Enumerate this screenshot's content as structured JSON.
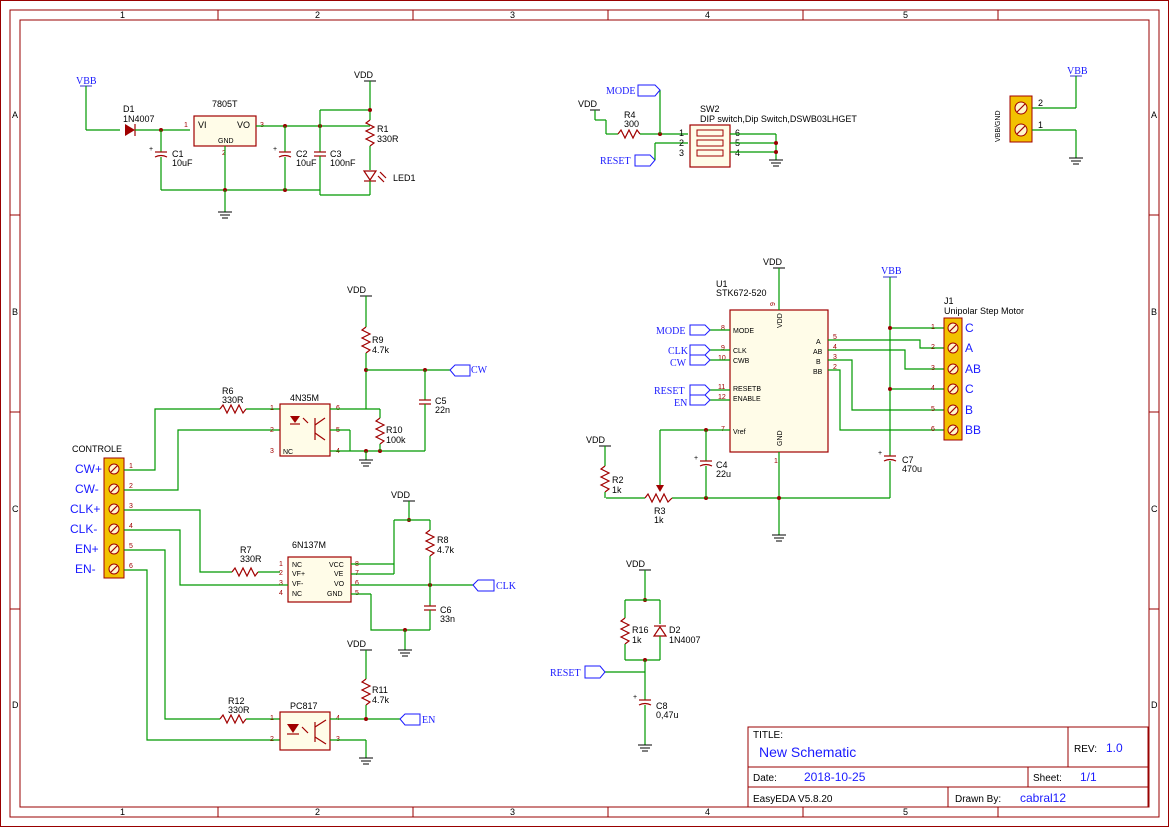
{
  "frame": {
    "columns": [
      "1",
      "2",
      "3",
      "4",
      "5"
    ],
    "rows": [
      "A",
      "B",
      "C",
      "D"
    ]
  },
  "title_block": {
    "title_label": "TITLE:",
    "title": "New Schematic",
    "rev_label": "REV:",
    "rev": "1.0",
    "date_label": "Date:",
    "date": "2018-10-25",
    "sheet_label": "Sheet:",
    "sheet": "1/1",
    "tool": "EasyEDA V5.8.20",
    "drawn_label": "Drawn By:",
    "drawn": "cabral12"
  },
  "power": {
    "vbb": "VBB",
    "vdd": "VDD"
  },
  "power_section": {
    "d1_ref": "D1",
    "d1_val": "1N4007",
    "reg_ref": "7805T",
    "reg_vi": "VI",
    "reg_vo": "VO",
    "reg_gnd": "GND",
    "c1_ref": "C1",
    "c1_val": "10uF",
    "c2_ref": "C2",
    "c2_val": "10uF",
    "c3_ref": "C3",
    "c3_val": "100nF",
    "r1_ref": "R1",
    "r1_val": "330R",
    "led_ref": "LED1"
  },
  "dip": {
    "r4_ref": "R4",
    "r4_val": "300",
    "sw_ref": "SW2",
    "sw_desc": "DIP switch,Dip Switch,DSWB03LHGET",
    "mode": "MODE",
    "reset": "RESET"
  },
  "vbb_conn": {
    "label": "VBB/GND",
    "pin2": "2",
    "pin1": "1"
  },
  "controle": {
    "title": "CONTROLE",
    "pins": [
      "CW+",
      "CW-",
      "CLK+",
      "CLK-",
      "EN+",
      "EN-"
    ],
    "nums": [
      "1",
      "2",
      "3",
      "4",
      "5",
      "6"
    ]
  },
  "opto1": {
    "ref": "4N35M",
    "r6_ref": "R6",
    "r6_val": "330R",
    "r9_ref": "R9",
    "r9_val": "4.7k",
    "r10_ref": "R10",
    "r10_val": "100k",
    "c5_ref": "C5",
    "c5_val": "22n",
    "nc": "NC",
    "net": "CW"
  },
  "opto2": {
    "ref": "6N137M",
    "r7_ref": "R7",
    "r7_val": "330R",
    "r8_ref": "R8",
    "r8_val": "4.7k",
    "c6_ref": "C6",
    "c6_val": "33n",
    "pins_left": [
      "NC",
      "VF+",
      "VF-",
      "NC"
    ],
    "pins_right": [
      "VCC",
      "VE",
      "VO",
      "GND"
    ],
    "net": "CLK"
  },
  "opto3": {
    "ref": "PC817",
    "r12_ref": "R12",
    "r12_val": "330R",
    "r11_ref": "R11",
    "r11_val": "4.7k",
    "net": "EN"
  },
  "driver": {
    "ref": "U1",
    "part": "STK672-520",
    "left_pins": [
      "MODE",
      "CLK",
      "CWB",
      "RESETB",
      "ENABLE",
      "Vref"
    ],
    "right_pins": [
      "A",
      "AB",
      "B",
      "BB"
    ],
    "vdd_pin": "VDD",
    "gnd_pin": "GND",
    "nets": [
      "MODE",
      "CLK",
      "CW",
      "RESET",
      "EN"
    ],
    "r2_ref": "R2",
    "r2_val": "1k",
    "r3_ref": "R3",
    "r3_val": "1k",
    "c4_ref": "C4",
    "c4_val": "22u",
    "c7_ref": "C7",
    "c7_val": "470u"
  },
  "motor": {
    "ref": "J1",
    "desc": "Unipolar Step Motor",
    "labels": [
      "C",
      "A",
      "AB",
      "C",
      "B",
      "BB"
    ]
  },
  "reset_circuit": {
    "r16_ref": "R16",
    "r16_val": "1k",
    "d2_ref": "D2",
    "d2_val": "1N4007",
    "c8_ref": "C8",
    "c8_val": "0,47u",
    "net": "RESET"
  }
}
